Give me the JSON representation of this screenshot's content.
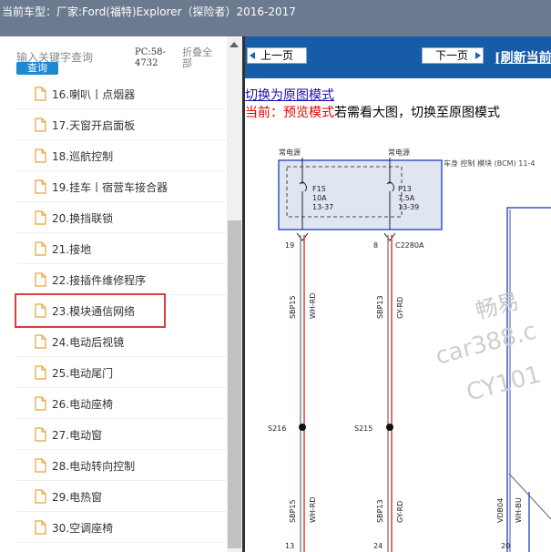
{
  "window": {
    "title": "当前车型：厂家:Ford(福特)Explorer（探险者）2016-2017"
  },
  "sidebar": {
    "search_placeholder": "输入关键字查询",
    "query_label": "查询",
    "pc_id": "PC:58-4732",
    "collapse_all": "折叠全部",
    "items": [
      {
        "label": "16.喇叭丨点烟器"
      },
      {
        "label": "17.天窗开启面板"
      },
      {
        "label": "18.巡航控制"
      },
      {
        "label": "19.挂车丨宿营车接合器"
      },
      {
        "label": "20.换挡联锁"
      },
      {
        "label": "21.接地"
      },
      {
        "label": "22.接插件维修程序"
      },
      {
        "label": "23.模块通信网络",
        "selected": true
      },
      {
        "label": "24.电动后视镜"
      },
      {
        "label": "25.电动尾门"
      },
      {
        "label": "26.电动座椅"
      },
      {
        "label": "27.电动窗"
      },
      {
        "label": "28.电动转向控制"
      },
      {
        "label": "29.电热窗"
      },
      {
        "label": "30.空调座椅"
      }
    ]
  },
  "viewer": {
    "prev_label": "上一页",
    "next_label": "下一页",
    "refresh_label": "[刷新当前",
    "switch_link": "切换为原图模式",
    "status_prefix": "当前：预览模式",
    "status_suffix": "若需看大图，切换至原图模式"
  },
  "diagram": {
    "power_left": "常电源",
    "power_right": "常电源",
    "module_name": "车身 控制 模块 (BCM) 11-4",
    "fuse1": {
      "id": "F15",
      "rating": "10A",
      "loc": "13-37"
    },
    "fuse2": {
      "id": "F13",
      "rating": "7.5A",
      "loc": "13-39"
    },
    "pin_left_top": "19",
    "pin_right_top": "8",
    "connector": "C2280A",
    "wire1_code": "SBP15",
    "wire1_color": "WH-RD",
    "wire2_code": "SBP13",
    "wire2_color": "GY-RD",
    "splice_left": "S216",
    "splice_right": "S215",
    "wire3_code": "VDB04",
    "wire3_color": "WH-BU",
    "pin_left_bottom": "13",
    "pin_mid_bottom": "24",
    "pin_right_bottom": "20",
    "watermark_1": "畅易",
    "watermark_2": "car388.c",
    "watermark_3": "CY101"
  }
}
